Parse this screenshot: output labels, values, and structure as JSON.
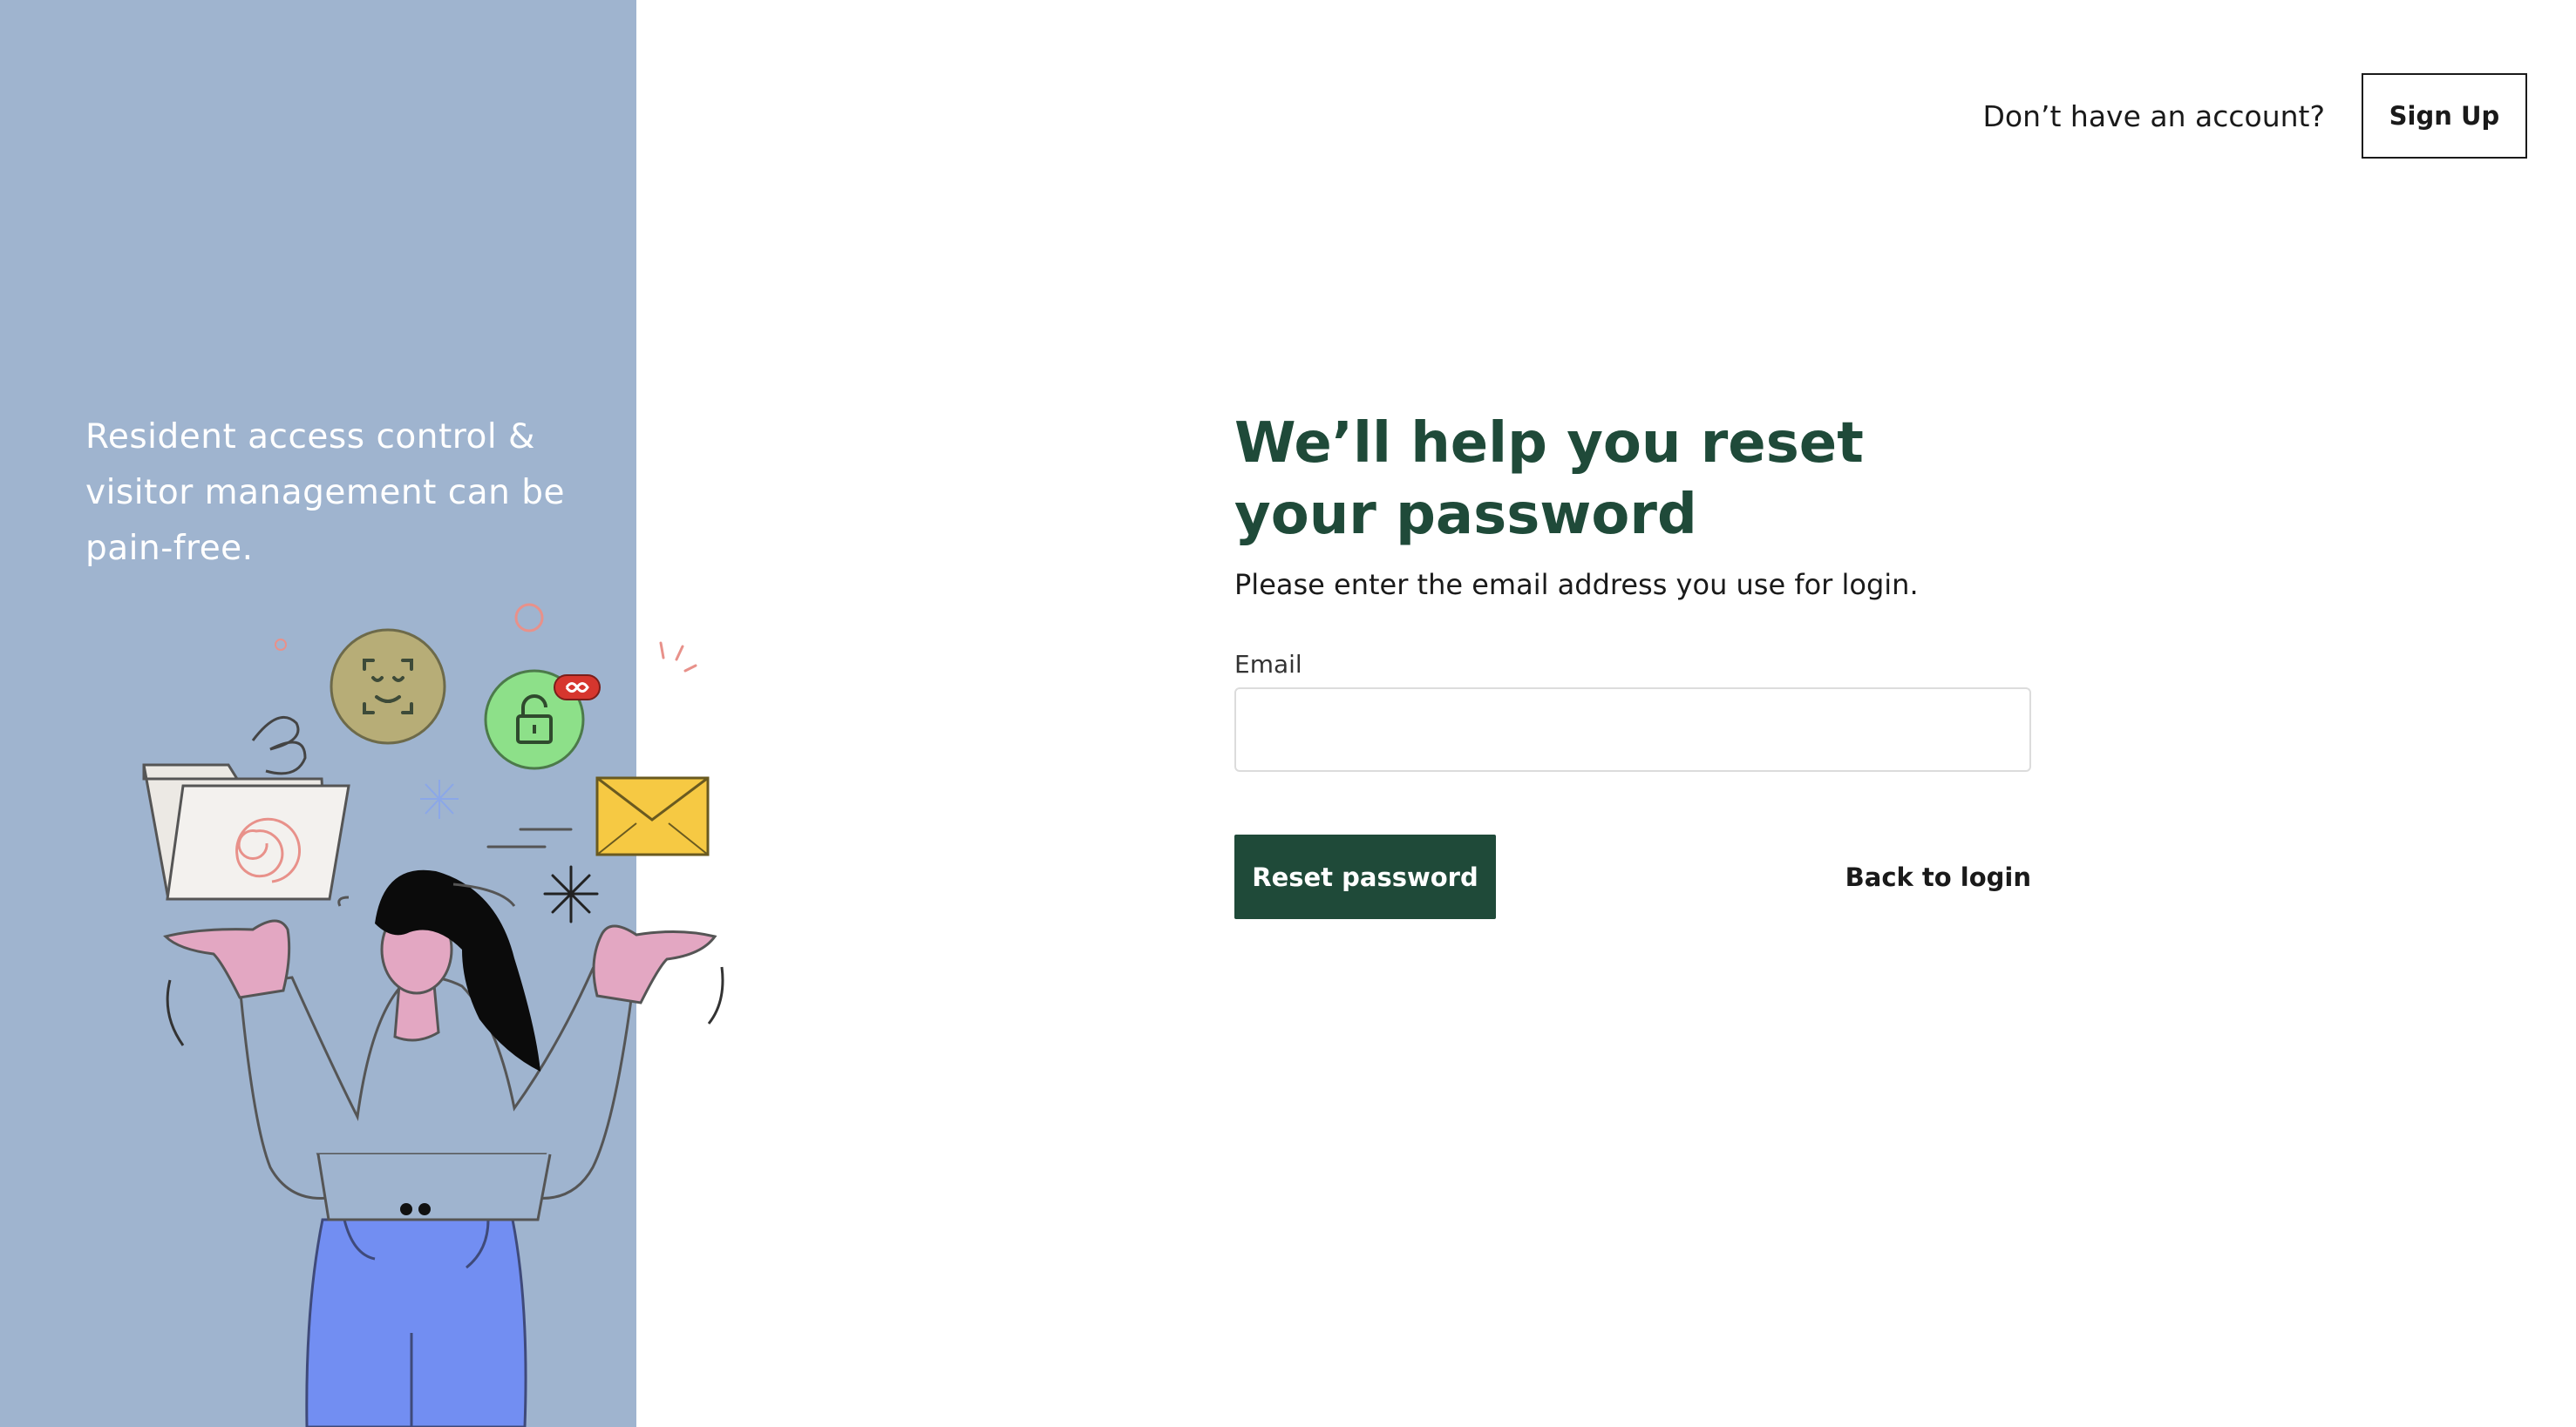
{
  "left_panel": {
    "tagline": "Resident access control & visitor management can be pain-free.",
    "background_color": "#9fb4cf",
    "illustration": {
      "icons": [
        "face-id-icon",
        "padlock-icon",
        "envelope-icon",
        "folder-icon",
        "infinity-badge-icon"
      ]
    }
  },
  "header": {
    "no_account_text": "Don’t have an account?",
    "signup_label": "Sign Up"
  },
  "form": {
    "title": "We’ll help you reset your password",
    "subtitle": "Please enter the email address you use for login.",
    "email_label": "Email",
    "email_value": "",
    "email_placeholder": "",
    "reset_label": "Reset password",
    "back_label": "Back to login"
  },
  "colors": {
    "brand_green": "#1f4a39",
    "text": "#1a1a1a",
    "panel_blue": "#9fb4cf"
  }
}
